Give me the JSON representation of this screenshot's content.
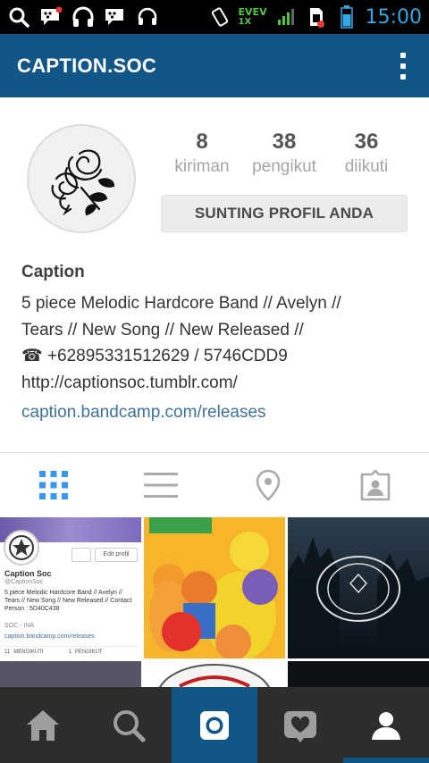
{
  "status_bar": {
    "network_line1": "EVEV",
    "network_line2": "1X",
    "time": "15:00"
  },
  "app_bar": {
    "title": "CAPTION.SOC"
  },
  "profile": {
    "stats": [
      {
        "value": "8",
        "label": "kiriman"
      },
      {
        "value": "38",
        "label": "pengikut"
      },
      {
        "value": "36",
        "label": "diikuti"
      }
    ],
    "edit_label": "SUNTING PROFIL ANDA",
    "name": "Caption",
    "bio": "5 piece Melodic Hardcore Band // Avelyn //\nTears // New Song // New Released //\n☎ +62895331512629 / 5746CDD9\nhttp://captionsoc.tumblr.com/",
    "link": "caption.bandcamp.com/releases"
  },
  "mini_profile": {
    "name": "Caption Soc",
    "handle": "@CaptionSoc",
    "edit": "Edit profil",
    "bio": "5 piece Melodic Hardcore Band // Avelyn // Tears // New Song // New Released // Contact Person : 5D40C438",
    "location": "SOC - INA",
    "link": "caption.bandcamp.com/releases",
    "following_count": "11",
    "following_label": "MENGIKUTI",
    "followers_count": "1",
    "followers_label": "PENGIKUT"
  },
  "icons": {
    "tabs": [
      "grid-view-icon",
      "list-view-icon",
      "location-icon",
      "tagged-photos-icon"
    ],
    "nav": [
      "home-icon",
      "search-icon",
      "camera-icon",
      "activity-icon",
      "profile-icon"
    ]
  },
  "colors": {
    "brand": "#125688",
    "link": "#3f729b",
    "active_tab": "#3897f0",
    "status_time": "#35a7e0"
  }
}
